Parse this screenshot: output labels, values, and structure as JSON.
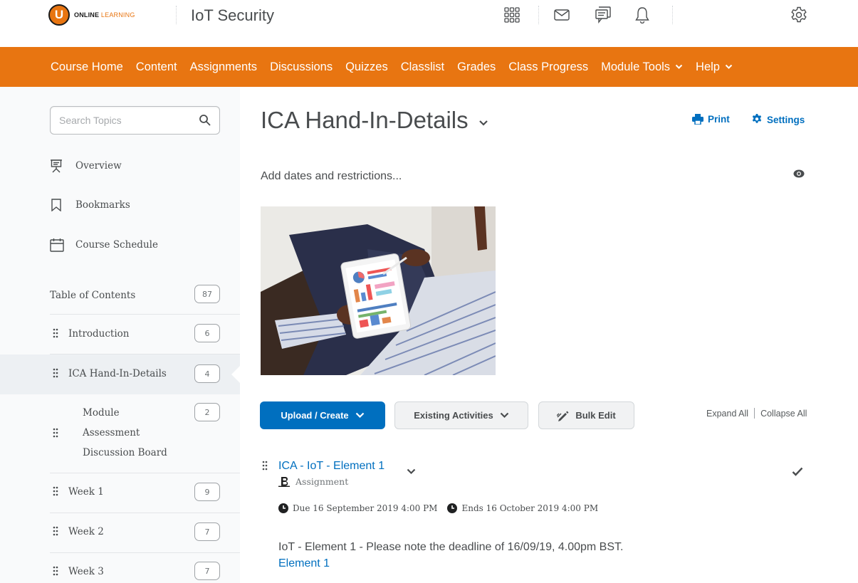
{
  "header": {
    "logo_letter": "U",
    "logo_text_1": "ONLINE",
    "logo_text_2": "LEARNING",
    "course_title": "IoT Security"
  },
  "nav": {
    "items": [
      "Course Home",
      "Content",
      "Assignments",
      "Discussions",
      "Quizzes",
      "Classlist",
      "Grades",
      "Class Progress"
    ],
    "module_tools": "Module Tools",
    "help": "Help"
  },
  "sidebar": {
    "search_placeholder": "Search Topics",
    "links": {
      "overview": "Overview",
      "bookmarks": "Bookmarks",
      "schedule": "Course Schedule"
    },
    "toc_label": "Table of Contents",
    "toc_count": "87",
    "modules": [
      {
        "label": "Introduction",
        "count": "6"
      },
      {
        "label": "ICA Hand-In-Details",
        "count": "4"
      },
      {
        "label_lines": [
          "Module",
          "Assessment",
          "Discussion Board"
        ],
        "count": "2"
      },
      {
        "label": "Week 1",
        "count": "9"
      },
      {
        "label": "Week 2",
        "count": "7"
      },
      {
        "label": "Week 3",
        "count": "7"
      }
    ]
  },
  "main": {
    "title": "ICA Hand-In-Details",
    "print": "Print",
    "settings": "Settings",
    "add_dates": "Add dates and restrictions...",
    "buttons": {
      "upload": "Upload / Create",
      "existing": "Existing Activities",
      "bulk": "Bulk Edit"
    },
    "expand_all": "Expand All",
    "collapse_all": "Collapse All",
    "item": {
      "title": "ICA - IoT - Element 1",
      "type": "Assignment",
      "due": "Due 16 September 2019 4:00 PM",
      "ends": "Ends 16 October 2019 4:00 PM",
      "description": "IoT - Element 1 - Please note the deadline of 16/09/19, 4.00pm BST.",
      "link": "Element 1"
    }
  },
  "colors": {
    "brand_orange": "#e87511",
    "link_blue": "#006fbf",
    "text": "#494c4e"
  }
}
